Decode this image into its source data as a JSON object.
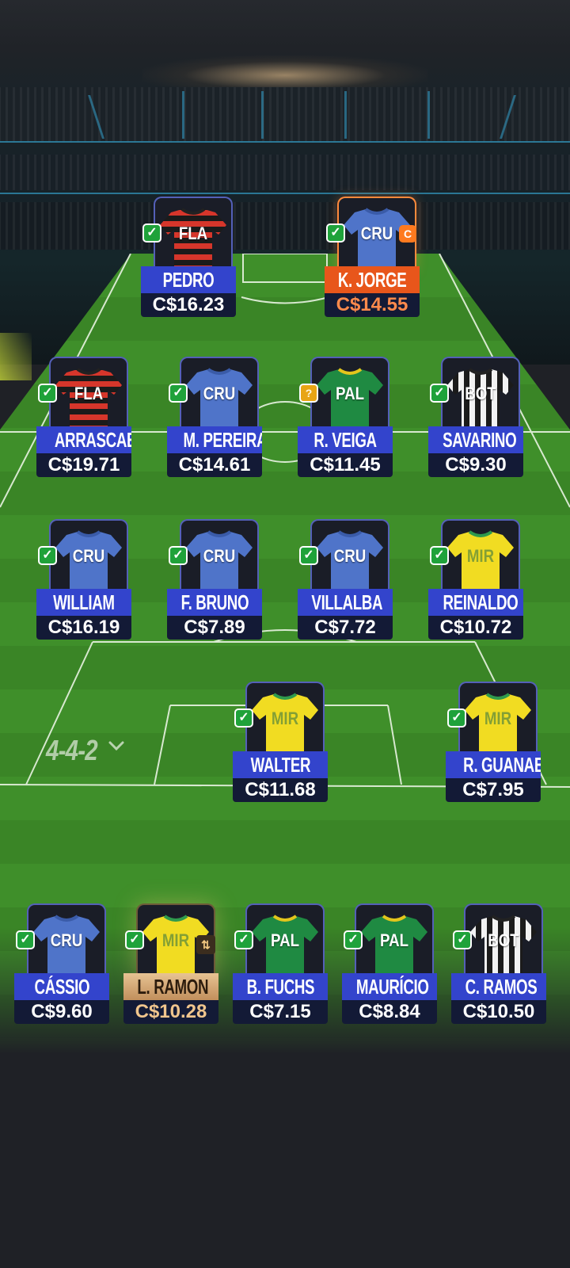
{
  "formation": "4-4-2",
  "captain_badge": "C",
  "swap_glyph": "⇅",
  "doubt_glyph": "?",
  "ok_glyph": "✓",
  "team_colors": {
    "FLA": {
      "kit": "stripes",
      "a": "#1b1b1b",
      "b": "#d6362b"
    },
    "CRU": {
      "kit": "solid",
      "a": "#4f74c9",
      "b": "#3a5ba8"
    },
    "PAL": {
      "kit": "solid",
      "a": "#1f8a42",
      "b": "#e3c51c"
    },
    "BOT": {
      "kit": "vstripes",
      "a": "#f2f2f2",
      "b": "#1b1b1b"
    },
    "MIR": {
      "kit": "solid",
      "a": "#f1dc22",
      "b": "#2f9a4d"
    }
  },
  "players": [
    {
      "id": "pedro",
      "name": "PEDRO",
      "team": "FLA",
      "price": "C$16.23",
      "status": "ok"
    },
    {
      "id": "kjorge",
      "name": "K. JORGE",
      "team": "CRU",
      "price": "C$14.55",
      "status": "ok",
      "captain": true
    },
    {
      "id": "arrascaeta",
      "name": "ARRASCAE...",
      "team": "FLA",
      "price": "C$19.71",
      "status": "ok"
    },
    {
      "id": "mpereira",
      "name": "M. PEREIRA",
      "team": "CRU",
      "price": "C$14.61",
      "status": "ok"
    },
    {
      "id": "rveiga",
      "name": "R. VEIGA",
      "team": "PAL",
      "price": "C$11.45",
      "status": "doubt"
    },
    {
      "id": "savarino",
      "name": "SAVARINO",
      "team": "BOT",
      "price": "C$9.30",
      "status": "ok"
    },
    {
      "id": "william",
      "name": "WILLIAM",
      "team": "CRU",
      "price": "C$16.19",
      "status": "ok"
    },
    {
      "id": "fbruno",
      "name": "F. BRUNO",
      "team": "CRU",
      "price": "C$7.89",
      "status": "ok"
    },
    {
      "id": "villalba",
      "name": "VILLALBA",
      "team": "CRU",
      "price": "C$7.72",
      "status": "ok"
    },
    {
      "id": "reinaldo",
      "name": "REINALDO",
      "team": "MIR",
      "price": "C$10.72",
      "status": "ok"
    },
    {
      "id": "walter",
      "name": "WALTER",
      "team": "MIR",
      "price": "C$11.68",
      "status": "ok"
    },
    {
      "id": "rguanaes",
      "name": "R. GUANAES",
      "team": "MIR",
      "price": "C$7.95",
      "status": "ok"
    },
    {
      "id": "cassio",
      "name": "CÁSSIO",
      "team": "CRU",
      "price": "C$9.60",
      "status": "ok"
    },
    {
      "id": "lramon",
      "name": "L. RAMON",
      "team": "MIR",
      "price": "C$10.28",
      "status": "ok",
      "gold": true
    },
    {
      "id": "bfuchs",
      "name": "B. FUCHS",
      "team": "PAL",
      "price": "C$7.15",
      "status": "ok"
    },
    {
      "id": "mauricio",
      "name": "MAURÍCIO",
      "team": "PAL",
      "price": "C$8.84",
      "status": "ok"
    },
    {
      "id": "cramos",
      "name": "C. RAMOS",
      "team": "BOT",
      "price": "C$10.50",
      "status": "ok"
    }
  ]
}
